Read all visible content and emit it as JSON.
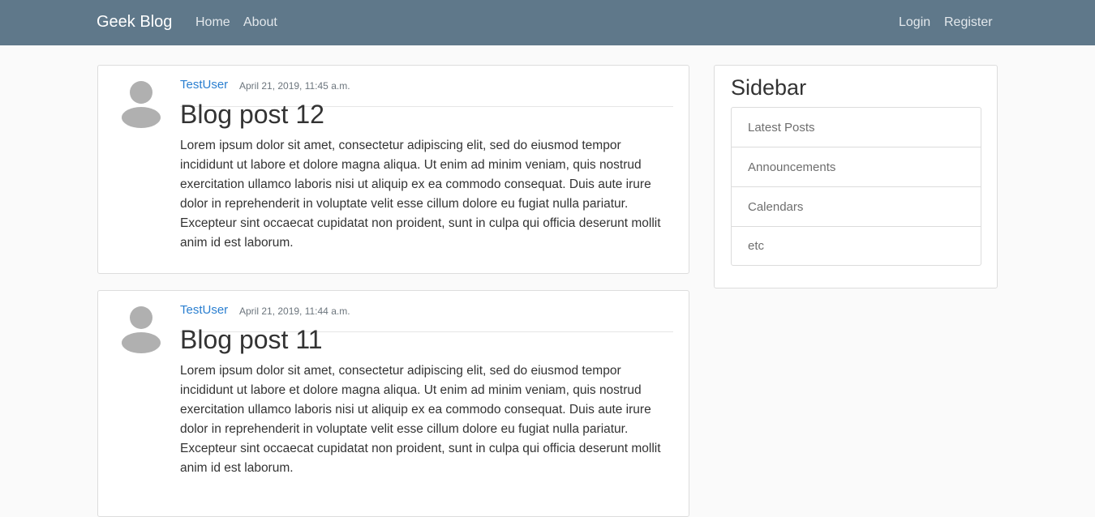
{
  "navbar": {
    "brand": "Geek Blog",
    "left_links": [
      "Home",
      "About"
    ],
    "right_links": [
      "Login",
      "Register"
    ],
    "background": "#5f788a"
  },
  "posts": [
    {
      "author": "TestUser",
      "date": "April 21, 2019, 11:45 a.m.",
      "title": "Blog post 12",
      "body": "Lorem ipsum dolor sit amet, consectetur adipiscing elit, sed do eiusmod tempor incididunt ut labore et dolore magna aliqua. Ut enim ad minim veniam, quis nostrud exercitation ullamco laboris nisi ut aliquip ex ea commodo consequat. Duis aute irure dolor in reprehenderit in voluptate velit esse cillum dolore eu fugiat nulla pariatur. Excepteur sint occaecat cupidatat non proident, sunt in culpa qui officia deserunt mollit anim id est laborum.",
      "avatar_icon": "user-avatar-icon"
    },
    {
      "author": "TestUser",
      "date": "April 21, 2019, 11:44 a.m.",
      "title": "Blog post 11",
      "body": "Lorem ipsum dolor sit amet, consectetur adipiscing elit, sed do eiusmod tempor incididunt ut labore et dolore magna aliqua. Ut enim ad minim veniam, quis nostrud exercitation ullamco laboris nisi ut aliquip ex ea commodo consequat. Duis aute irure dolor in reprehenderit in voluptate velit esse cillum dolore eu fugiat nulla pariatur. Excepteur sint occaecat cupidatat non proident, sunt in culpa qui officia deserunt mollit anim id est laborum.",
      "avatar_icon": "user-avatar-icon"
    }
  ],
  "sidebar": {
    "title": "Sidebar",
    "items": [
      "Latest Posts",
      "Announcements",
      "Calendars",
      "etc"
    ]
  },
  "colors": {
    "author_link": "#2b7fd0",
    "page_background": "#fafafa"
  }
}
